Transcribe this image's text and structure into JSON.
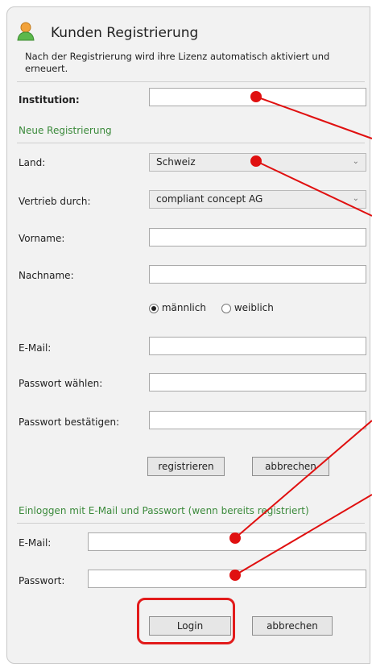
{
  "window": {
    "title": "Kunden Registrierung",
    "subtitle": "Nach der Registrierung wird ihre Lizenz automatisch aktiviert und erneuert."
  },
  "institution": {
    "label": "Institution:",
    "value": ""
  },
  "registration": {
    "section_title": "Neue Registrierung",
    "land_label": "Land:",
    "land_value": "Schweiz",
    "vertrieb_label": "Vertrieb durch:",
    "vertrieb_value": "compliant concept AG",
    "vorname_label": "Vorname:",
    "nachname_label": "Nachname:",
    "gender_male": "männlich",
    "gender_female": "weiblich",
    "email_label": "E-Mail:",
    "password_label": "Passwort wählen:",
    "password_confirm_label": "Passwort bestätigen:",
    "register_button": "registrieren",
    "cancel_button": "abbrechen"
  },
  "login": {
    "section_title": "Einloggen mit E-Mail und Passwort (wenn bereits registriert)",
    "email_label": "E-Mail:",
    "password_label": "Passwort:",
    "login_button": "Login",
    "cancel_button": "abbrechen"
  },
  "colors": {
    "section_green": "#3b8a3b",
    "annotation_red": "#e21b1b"
  },
  "icons": {
    "title_icon": "user-icon"
  }
}
